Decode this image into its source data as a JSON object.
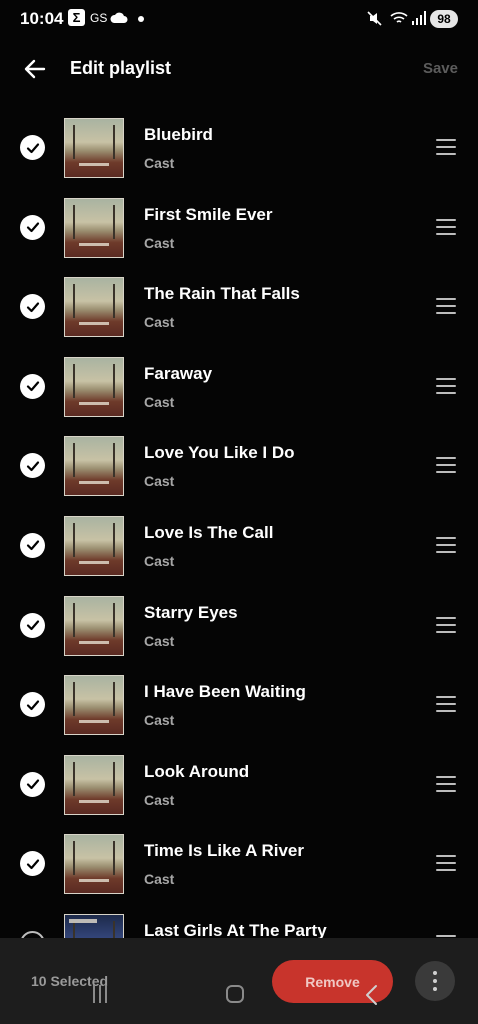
{
  "status_bar": {
    "time": "10:04",
    "sigma": "Σ",
    "gs": "GS",
    "battery": "98"
  },
  "header": {
    "title": "Edit playlist",
    "save_label": "Save"
  },
  "tracks": [
    {
      "title": "Bluebird",
      "artist": "Cast",
      "checked": true
    },
    {
      "title": "First Smile Ever",
      "artist": "Cast",
      "checked": true
    },
    {
      "title": "The Rain That Falls",
      "artist": "Cast",
      "checked": true
    },
    {
      "title": "Faraway",
      "artist": "Cast",
      "checked": true
    },
    {
      "title": "Love You Like I Do",
      "artist": "Cast",
      "checked": true
    },
    {
      "title": "Love Is The Call",
      "artist": "Cast",
      "checked": true
    },
    {
      "title": "Starry Eyes",
      "artist": "Cast",
      "checked": true
    },
    {
      "title": "I Have Been Waiting",
      "artist": "Cast",
      "checked": true
    },
    {
      "title": "Look Around",
      "artist": "Cast",
      "checked": true
    },
    {
      "title": "Time Is Like A River",
      "artist": "Cast",
      "checked": true
    },
    {
      "title": "Last Girls At The Party",
      "artist": "",
      "checked": false
    }
  ],
  "action_bar": {
    "selected_label": "10 Selected",
    "remove_label": "Remove"
  },
  "colors": {
    "background": "#050505",
    "remove_button": "#c8342c",
    "secondary_text": "#a7a7a7"
  }
}
